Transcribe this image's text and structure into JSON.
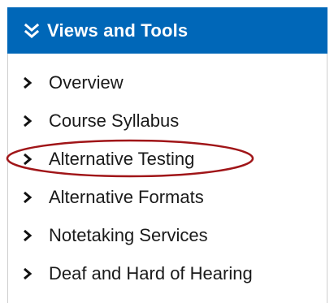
{
  "panel": {
    "title": "Views and Tools",
    "header_icon": "double-chevron-down-icon",
    "accent_color": "#0067b8",
    "highlight_color": "#a01518",
    "items": [
      {
        "label": "Overview",
        "icon": "chevron-right-icon"
      },
      {
        "label": "Course Syllabus",
        "icon": "chevron-right-icon"
      },
      {
        "label": "Alternative Testing",
        "icon": "chevron-right-icon",
        "highlighted": true
      },
      {
        "label": "Alternative Formats",
        "icon": "chevron-right-icon"
      },
      {
        "label": "Notetaking Services",
        "icon": "chevron-right-icon"
      },
      {
        "label": "Deaf and Hard of Hearing",
        "icon": "chevron-right-icon"
      }
    ]
  }
}
